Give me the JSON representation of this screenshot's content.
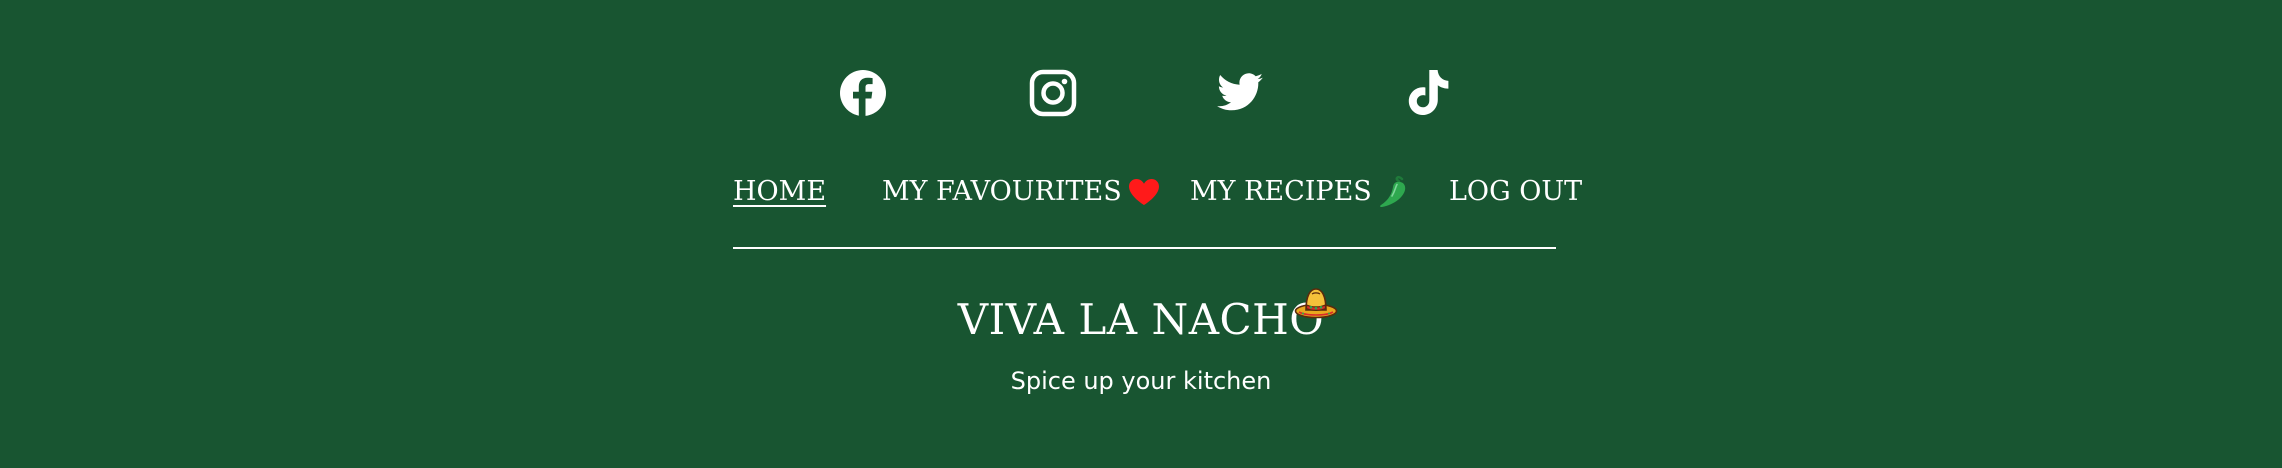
{
  "social": {
    "facebook": {
      "icon": "facebook-icon"
    },
    "instagram": {
      "icon": "instagram-icon"
    },
    "twitter": {
      "icon": "twitter-icon"
    },
    "tiktok": {
      "icon": "tiktok-icon"
    }
  },
  "nav": {
    "items": [
      {
        "label": "HOME",
        "active": true
      },
      {
        "label": "MY FAVOURITES",
        "icon": "heart-icon",
        "icon_color": "#ff1a1a"
      },
      {
        "label": "MY RECIPES",
        "icon": "chili-pepper-icon",
        "icon_color": "#2ea84f"
      },
      {
        "label": "LOG OUT"
      }
    ]
  },
  "brand": {
    "title": "VIVA LA NACHO",
    "tagline": "Spice up your kitchen",
    "icon": "sombrero-icon"
  },
  "colors": {
    "background": "#185531",
    "text": "#ffffff"
  }
}
